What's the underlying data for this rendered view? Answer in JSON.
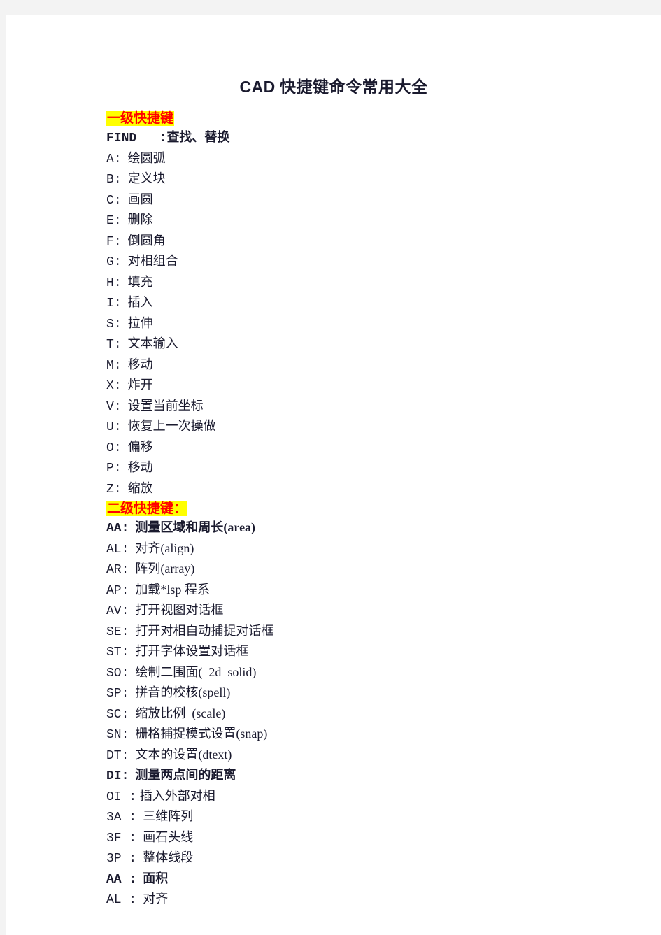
{
  "document": {
    "title": "CAD 快捷键命令常用大全",
    "title_latin": "CAD",
    "title_cjk": " 快捷键命令常用大全",
    "page_background": "#ffffff",
    "canvas_background": "#f3f3f3",
    "highlight_color": "#ffff00",
    "highlight_text_color": "#ff0000",
    "body_text_color": "#1a1a2e"
  },
  "sections": [
    {
      "heading": "一级快捷键",
      "heading_highlighted": true,
      "entries": [
        {
          "key": "FIND",
          "sep": "   :",
          "desc": "查找、替换",
          "bold": true
        },
        {
          "key": "A:",
          "sep": "",
          "desc": "  绘圆弧",
          "bold": false
        },
        {
          "key": "B:",
          "sep": "",
          "desc": "  定义块",
          "bold": false
        },
        {
          "key": "C:",
          "sep": "",
          "desc": "  画圆",
          "bold": false
        },
        {
          "key": "E:",
          "sep": "",
          "desc": "  删除",
          "bold": false
        },
        {
          "key": "F:",
          "sep": "",
          "desc": "  倒圆角",
          "bold": false
        },
        {
          "key": "G:",
          "sep": "",
          "desc": "  对相组合",
          "bold": false
        },
        {
          "key": "H:",
          "sep": "",
          "desc": "  填充",
          "bold": false
        },
        {
          "key": "I:",
          "sep": "",
          "desc": "  插入",
          "bold": false
        },
        {
          "key": "S:",
          "sep": "",
          "desc": "  拉伸",
          "bold": false
        },
        {
          "key": "T:",
          "sep": "",
          "desc": "  文本输入",
          "bold": false
        },
        {
          "key": "M:",
          "sep": "",
          "desc": "  移动",
          "bold": false
        },
        {
          "key": "X:",
          "sep": "",
          "desc": "  炸开",
          "bold": false
        },
        {
          "key": "V:",
          "sep": "",
          "desc": "  设置当前坐标",
          "bold": false
        },
        {
          "key": "U:",
          "sep": "",
          "desc": "  恢复上一次操做",
          "bold": false
        },
        {
          "key": "O:",
          "sep": "",
          "desc": "  偏移",
          "bold": false
        },
        {
          "key": "P:",
          "sep": "",
          "desc": "  移动",
          "bold": false
        },
        {
          "key": "Z:",
          "sep": "",
          "desc": "  缩放",
          "bold": false
        }
      ]
    },
    {
      "heading": "二级快捷键：",
      "heading_highlighted": true,
      "entries": [
        {
          "key": "AA:",
          "sep": "",
          "desc": "  测量区域和周长(area)",
          "bold": true
        },
        {
          "key": "AL:",
          "sep": "",
          "desc": "  对齐(align)",
          "bold": false
        },
        {
          "key": "AR:",
          "sep": "",
          "desc": "  阵列(array)",
          "bold": false
        },
        {
          "key": "AP:",
          "sep": "",
          "desc": "  加载*lsp 程系",
          "bold": false
        },
        {
          "key": "AV:",
          "sep": "",
          "desc": "  打开视图对话框",
          "bold": false
        },
        {
          "key": "SE:",
          "sep": "",
          "desc": "  打开对相自动捕捉对话框",
          "bold": false
        },
        {
          "key": "ST:",
          "sep": "",
          "desc": "  打开字体设置对话框",
          "bold": false
        },
        {
          "key": "SO:",
          "sep": "",
          "desc": "  绘制二围面(  2d  solid)",
          "bold": false
        },
        {
          "key": "SP:",
          "sep": "",
          "desc": "  拼音的校核(spell)",
          "bold": false
        },
        {
          "key": "SC:",
          "sep": "",
          "desc": "  缩放比例  (scale)",
          "bold": false
        },
        {
          "key": "SN:",
          "sep": "",
          "desc": "  栅格捕捉模式设置(snap)",
          "bold": false
        },
        {
          "key": "DT:",
          "sep": "",
          "desc": "  文本的设置(dtext)",
          "bold": false
        },
        {
          "key": "DI:",
          "sep": "",
          "desc": "  测量两点间的距离",
          "bold": true
        },
        {
          "key": "OI",
          "sep": " :",
          "desc": " 插入外部对相",
          "bold": false
        },
        {
          "key": "3A",
          "sep": " :",
          "desc": "  三维阵列",
          "bold": false
        },
        {
          "key": "3F",
          "sep": " :",
          "desc": "  画石头线",
          "bold": false
        },
        {
          "key": "3P",
          "sep": " :",
          "desc": "  整体线段",
          "bold": false
        },
        {
          "key": "AA",
          "sep": " :",
          "desc": "  面积",
          "bold": true
        },
        {
          "key": "AL",
          "sep": " :",
          "desc": "  对齐",
          "bold": false
        }
      ]
    }
  ]
}
